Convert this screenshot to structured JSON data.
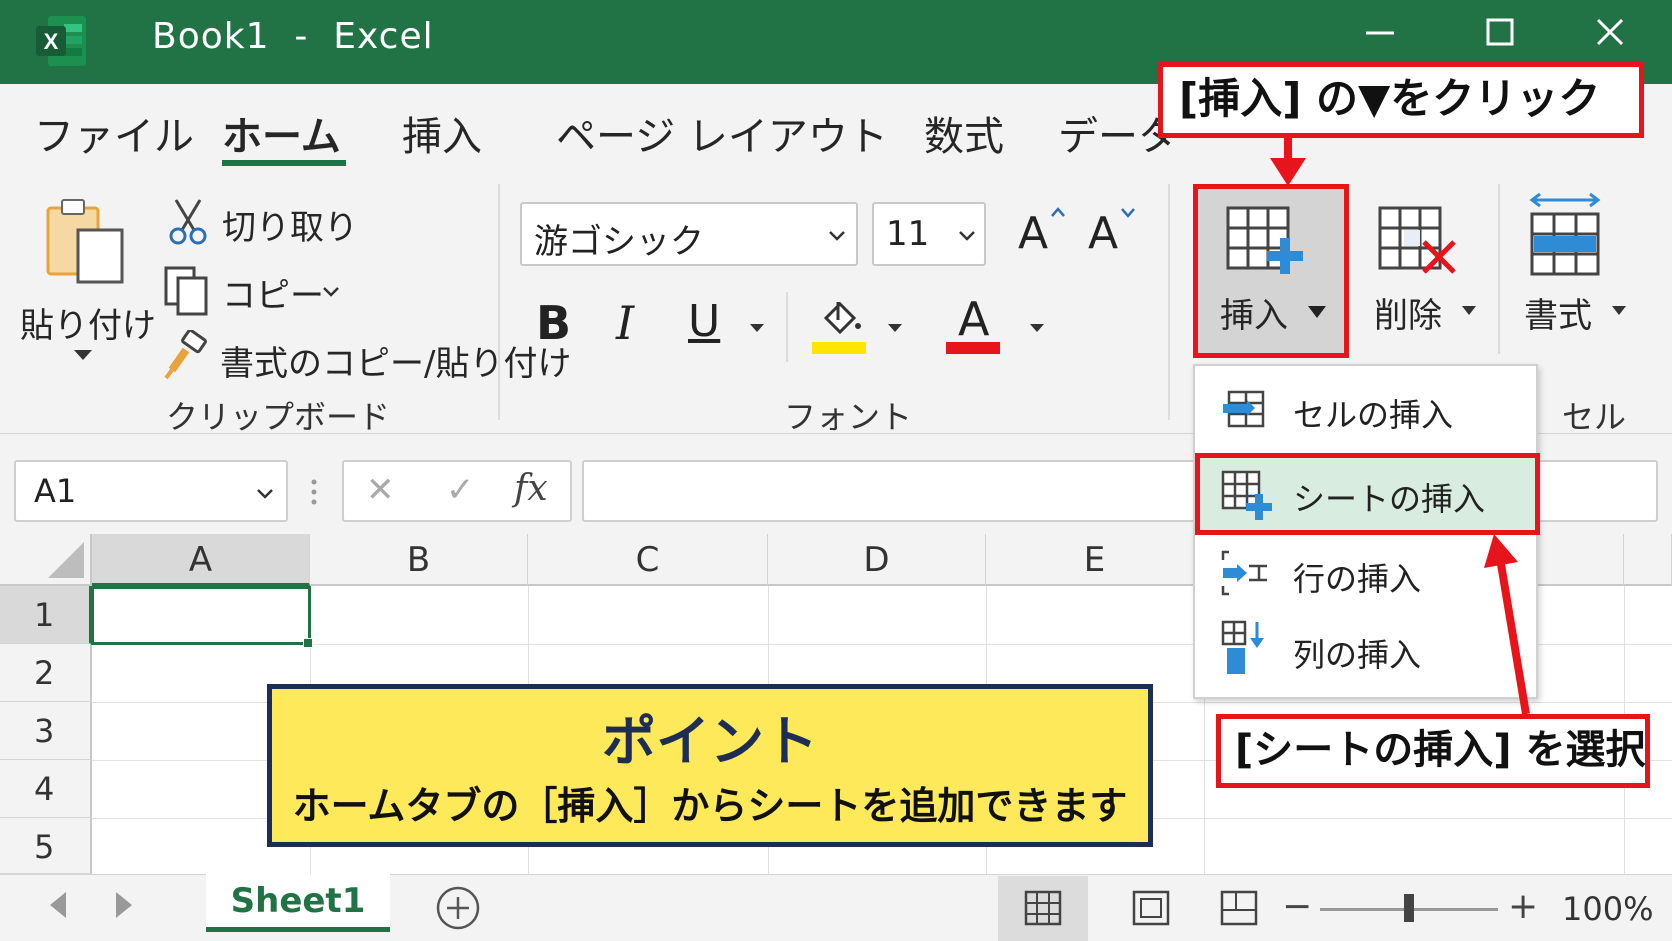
{
  "app": {
    "title": "Book1  -  Excel",
    "brand_color": "#217346",
    "logo_letter": "X"
  },
  "ribbon": {
    "tabs": [
      "ファイル",
      "ホーム",
      "挿入",
      "ページ レイアウト",
      "数式",
      "データ"
    ],
    "active_tab": "ホーム",
    "clipboard": {
      "paste_label": "貼り付け",
      "cut_label": "切り取り",
      "copy_label": "コピー",
      "format_painter_label": "書式のコピー/貼り付け",
      "group_label": "クリップボード"
    },
    "font": {
      "font_name": "游ゴシック",
      "font_size": "11",
      "grow_label": "A",
      "shrink_label": "A",
      "bold_label": "B",
      "italic_label": "I",
      "underline_label": "U",
      "font_color_label": "A",
      "highlight_color": "#ffe500",
      "font_color": "#e8141c",
      "group_label": "フォント"
    },
    "cells": {
      "insert_label": "挿入",
      "delete_label": "削除",
      "format_label": "書式",
      "group_label": "セル"
    }
  },
  "callouts": {
    "top": "[挿入] の▼をクリック",
    "bottom": "[シートの挿入] を選択",
    "color": "#e8141c"
  },
  "insert_menu": {
    "items": [
      {
        "label": "セルの挿入",
        "icon": "insert-cells-icon"
      },
      {
        "label": "シートの挿入",
        "icon": "insert-sheet-icon",
        "selected": true
      },
      {
        "label": "行の挿入",
        "icon": "insert-rows-icon"
      },
      {
        "label": "列の挿入",
        "icon": "insert-columns-icon"
      }
    ]
  },
  "formula_bar": {
    "name_box": "A1",
    "fx_label": "fx",
    "cancel_glyph": "✕",
    "enter_glyph": "✓"
  },
  "grid": {
    "columns": [
      "A",
      "B",
      "C",
      "D",
      "E"
    ],
    "rows": [
      "1",
      "2",
      "3",
      "4",
      "5"
    ],
    "selected_cell": "A1"
  },
  "point": {
    "title": "ポイント",
    "body": "ホームタブの［挿入］からシートを追加できます"
  },
  "status": {
    "sheet_name": "Sheet1",
    "zoom": "100%",
    "zoom_minus": "−",
    "zoom_plus": "+"
  }
}
